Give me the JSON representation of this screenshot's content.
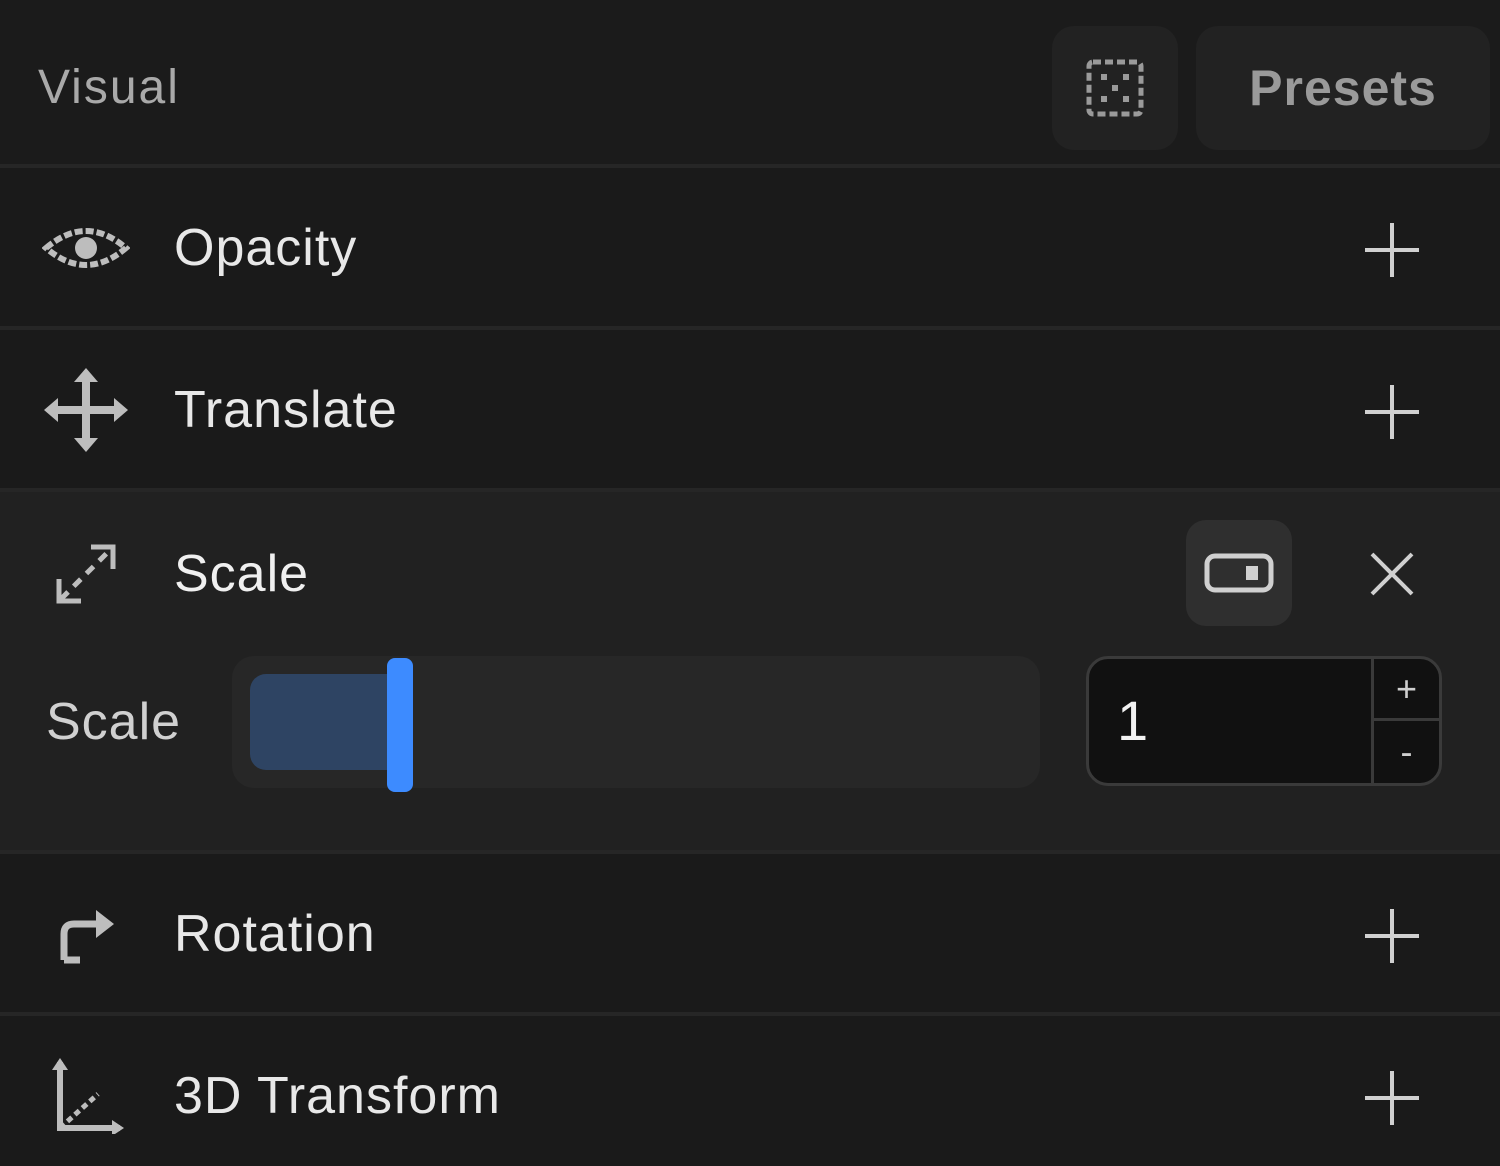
{
  "panel": {
    "title": "Visual",
    "dice_icon": "dice-icon",
    "presets_label": "Presets"
  },
  "rows": {
    "opacity": {
      "label": "Opacity",
      "icon": "eye-icon"
    },
    "translate": {
      "label": "Translate",
      "icon": "move-arrows-icon"
    },
    "scale": {
      "label": "Scale",
      "icon": "resize-arrows-icon"
    },
    "rotation": {
      "label": "Rotation",
      "icon": "rotate-arrow-icon"
    },
    "transform3d": {
      "label": "3D Transform",
      "icon": "axes-3d-icon"
    }
  },
  "scale_control": {
    "param_label": "Scale",
    "value": "1",
    "slider_fraction": 0.18,
    "stepper_up": "+",
    "stepper_down": "-"
  },
  "colors": {
    "background": "#1a1a1a",
    "accent": "#3d8bff",
    "slider_fill": "#2e4463"
  }
}
